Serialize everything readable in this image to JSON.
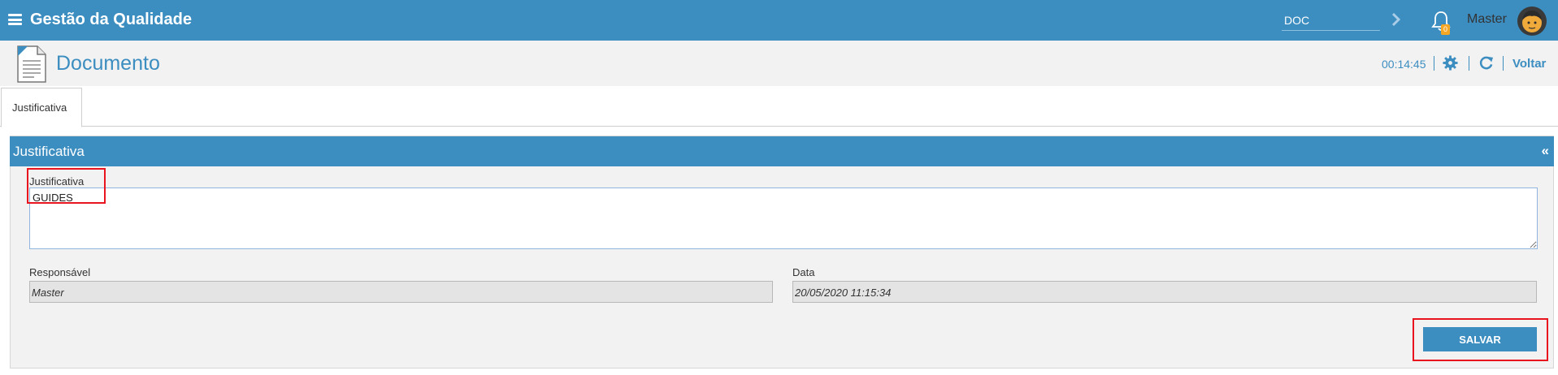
{
  "topbar": {
    "app_title": "Gestão da Qualidade",
    "search_value": "DOC",
    "notification_count": "0",
    "user_name": "Master"
  },
  "subheader": {
    "page_title": "Documento",
    "timer": "00:14:45",
    "back_label": "Voltar"
  },
  "tabs": [
    {
      "label": "Justificativa"
    }
  ],
  "panel": {
    "title": "Justificativa",
    "collapse_glyph": "«",
    "justificativa_label": "Justificativa",
    "justificativa_value": "GUIDES",
    "responsavel_label": "Responsável",
    "responsavel_value": "Master",
    "data_label": "Data",
    "data_value": "20/05/2020 11:15:34",
    "save_label": "SALVAR"
  },
  "colors": {
    "primary": "#3c8dc0",
    "highlight": "#e8141e",
    "badge": "#f5a623"
  },
  "icons": [
    "menu-icon",
    "chevron-right-icon",
    "bell-icon",
    "avatar-icon",
    "document-icon",
    "gear-icon",
    "refresh-icon"
  ]
}
